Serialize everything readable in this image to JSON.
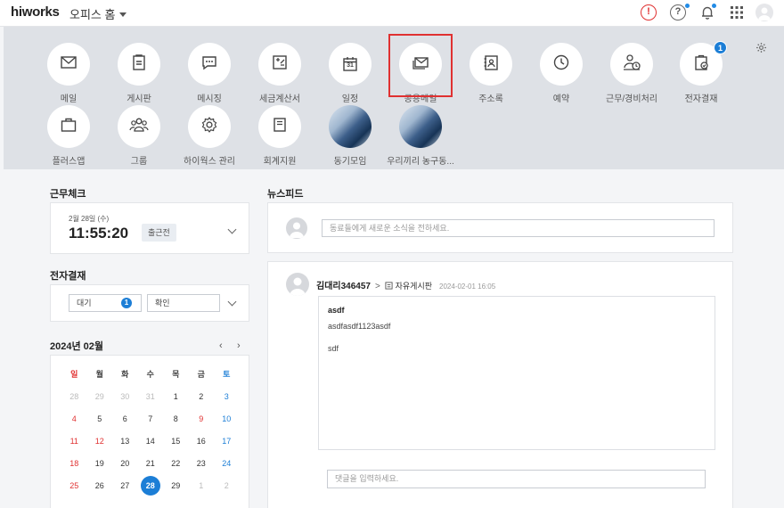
{
  "topbar": {
    "logo": "hiworks",
    "home_label": "오피스 홈",
    "alert_glyph": "!",
    "help_glyph": "?"
  },
  "apps": [
    {
      "label": "메일",
      "icon": "mail-icon"
    },
    {
      "label": "게시판",
      "icon": "board-icon"
    },
    {
      "label": "메시징",
      "icon": "chat-icon"
    },
    {
      "label": "세금계산서",
      "icon": "tax-invoice-icon"
    },
    {
      "label": "일정",
      "icon": "calendar-icon",
      "glyph": "31"
    },
    {
      "label": "공용메일",
      "icon": "shared-mail-icon"
    },
    {
      "label": "주소록",
      "icon": "address-book-icon"
    },
    {
      "label": "예약",
      "icon": "clock-icon"
    },
    {
      "label": "근무/경비처리",
      "icon": "work-expense-icon"
    },
    {
      "label": "전자결재",
      "icon": "approval-icon",
      "badge": "1"
    },
    {
      "label": "플러스앱",
      "icon": "briefcase-icon"
    },
    {
      "label": "그룹",
      "icon": "group-icon"
    },
    {
      "label": "하이웍스 관리",
      "icon": "gear-icon"
    },
    {
      "label": "회계지원",
      "icon": "accounting-icon"
    },
    {
      "label": "동기모임",
      "icon": "group-photo-icon"
    },
    {
      "label": "우리끼리 농구동...",
      "icon": "group-photo-icon"
    }
  ],
  "attendance": {
    "title": "근무체크",
    "date": "2월 28일 (수)",
    "time": "11:55:20",
    "status": "출근전"
  },
  "approval": {
    "title": "전자결재",
    "waiting_label": "대기",
    "waiting_count": "1",
    "confirm_label": "확인"
  },
  "calendar": {
    "title": "2024년 02월",
    "prev": "‹",
    "next": "›",
    "weekdays": [
      "일",
      "월",
      "화",
      "수",
      "목",
      "금",
      "토"
    ],
    "weeks": [
      [
        "28",
        "29",
        "30",
        "31",
        "1",
        "2",
        "3"
      ],
      [
        "4",
        "5",
        "6",
        "7",
        "8",
        "9",
        "10"
      ],
      [
        "11",
        "12",
        "13",
        "14",
        "15",
        "16",
        "17"
      ],
      [
        "18",
        "19",
        "20",
        "21",
        "22",
        "23",
        "24"
      ],
      [
        "25",
        "26",
        "27",
        "28",
        "29",
        "1",
        "2"
      ]
    ],
    "holiday_dates": [
      "9",
      "12"
    ],
    "today": "28"
  },
  "newsfeed": {
    "title": "뉴스피드",
    "compose_placeholder": "동료들에게 새로운 소식을 전하세요.",
    "post": {
      "author": "김대리346457",
      "arrow": ">",
      "board": "자유게시판",
      "date": "2024-02-01 16:05",
      "title": "asdf",
      "lines": [
        "asdfasdf1123asdf",
        "sdf"
      ]
    },
    "comment_placeholder": "댓글을 입력하세요."
  },
  "colors": {
    "accent": "#1c7ed6",
    "alert": "#e03131",
    "panel": "#dee1e6"
  }
}
